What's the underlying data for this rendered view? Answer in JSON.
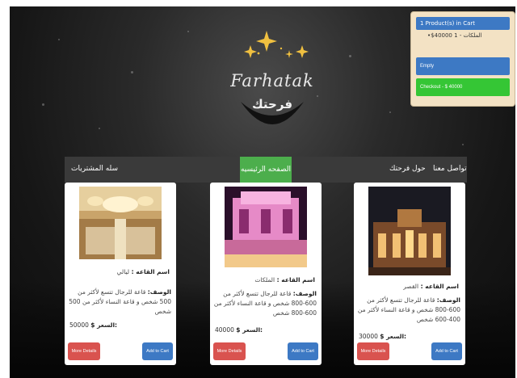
{
  "logo": {
    "title": "Farhatak",
    "arabic": "فرحتك"
  },
  "cart": {
    "header": "1 Product(s) in Cart",
    "items": [
      {
        "text": "الملكات - 1 40000$"
      }
    ],
    "empty_label": "Empty",
    "checkout_label": "Checkout - $ 40000"
  },
  "nav": {
    "cart_label": "سله المشتريات",
    "home_label": "الصفحه الرئيسيه",
    "about_label": "حول فرحتك",
    "contact_label": "تواصل معنا"
  },
  "halls": [
    {
      "name_label": "اسم القاعه :",
      "name": "ليالي",
      "desc_label": "الوصف:",
      "desc": "قاعة للرجال تتسع لأكثر من 500 شخص و قاعة النساء لأكثر من 500 شخص",
      "price_label": "$ السعر:",
      "price": "50000",
      "more_label": "More Details",
      "add_label": "Add to Cart"
    },
    {
      "name_label": "اسم القاعه :",
      "name": "الملكات",
      "desc_label": "الوصف:",
      "desc": "قاعة للرجال تتسع لأكثر من 600-800 شخص و قاعة النساء لأكثر من 600-800 شخص",
      "price_label": "$ السعر:",
      "price": "40000",
      "more_label": "More Details",
      "add_label": "Add to Cart"
    },
    {
      "name_label": "اسم القاعه :",
      "name": "القصر",
      "desc_label": "الوصف:",
      "desc": "قاعة للرجال تتسع لأكثر من 600-800 شخص و قاعة النساء لأكثر من 400-600 شخص",
      "price_label": "$ السعر:",
      "price": "30000",
      "more_label": "More Details",
      "add_label": "Add to Cart"
    }
  ],
  "colors": {
    "primary_blue": "#3d79c4",
    "success_green": "#35c635",
    "danger_red": "#d9534f",
    "nav_active": "#4cae4c",
    "cart_bg": "#f3e2c4"
  }
}
